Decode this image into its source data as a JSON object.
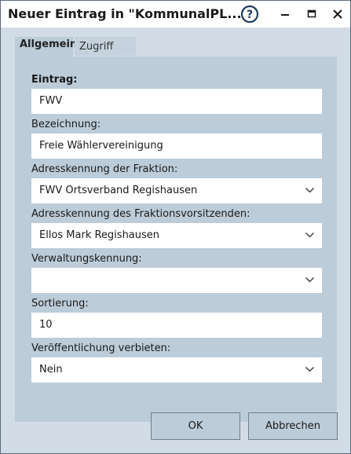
{
  "window": {
    "title": "Neuer Eintrag in \"KommunalPL..."
  },
  "tabs": [
    {
      "label": "Allgemein",
      "active": true
    },
    {
      "label": "Zugriff",
      "active": false
    }
  ],
  "form": {
    "eintrag": {
      "label": "Eintrag:",
      "value": "FWV"
    },
    "bezeichnung": {
      "label": "Bezeichnung:",
      "value": "Freie Wählervereinigung"
    },
    "adresskennung_fraktion": {
      "label": "Adresskennung der Fraktion:",
      "value": "FWV Ortsverband Regishausen"
    },
    "adresskennung_vorsitz": {
      "label": "Adresskennung des Fraktionsvorsitzenden:",
      "value": "Ellos Mark Regishausen"
    },
    "verwaltungskennung": {
      "label": "Verwaltungskennung:",
      "value": ""
    },
    "sortierung": {
      "label": "Sortierung:",
      "value": "10"
    },
    "veroeffentlichung": {
      "label": "Veröffentlichung verbieten:",
      "value": "Nein"
    }
  },
  "buttons": {
    "ok": "OK",
    "cancel": "Abbrechen"
  }
}
